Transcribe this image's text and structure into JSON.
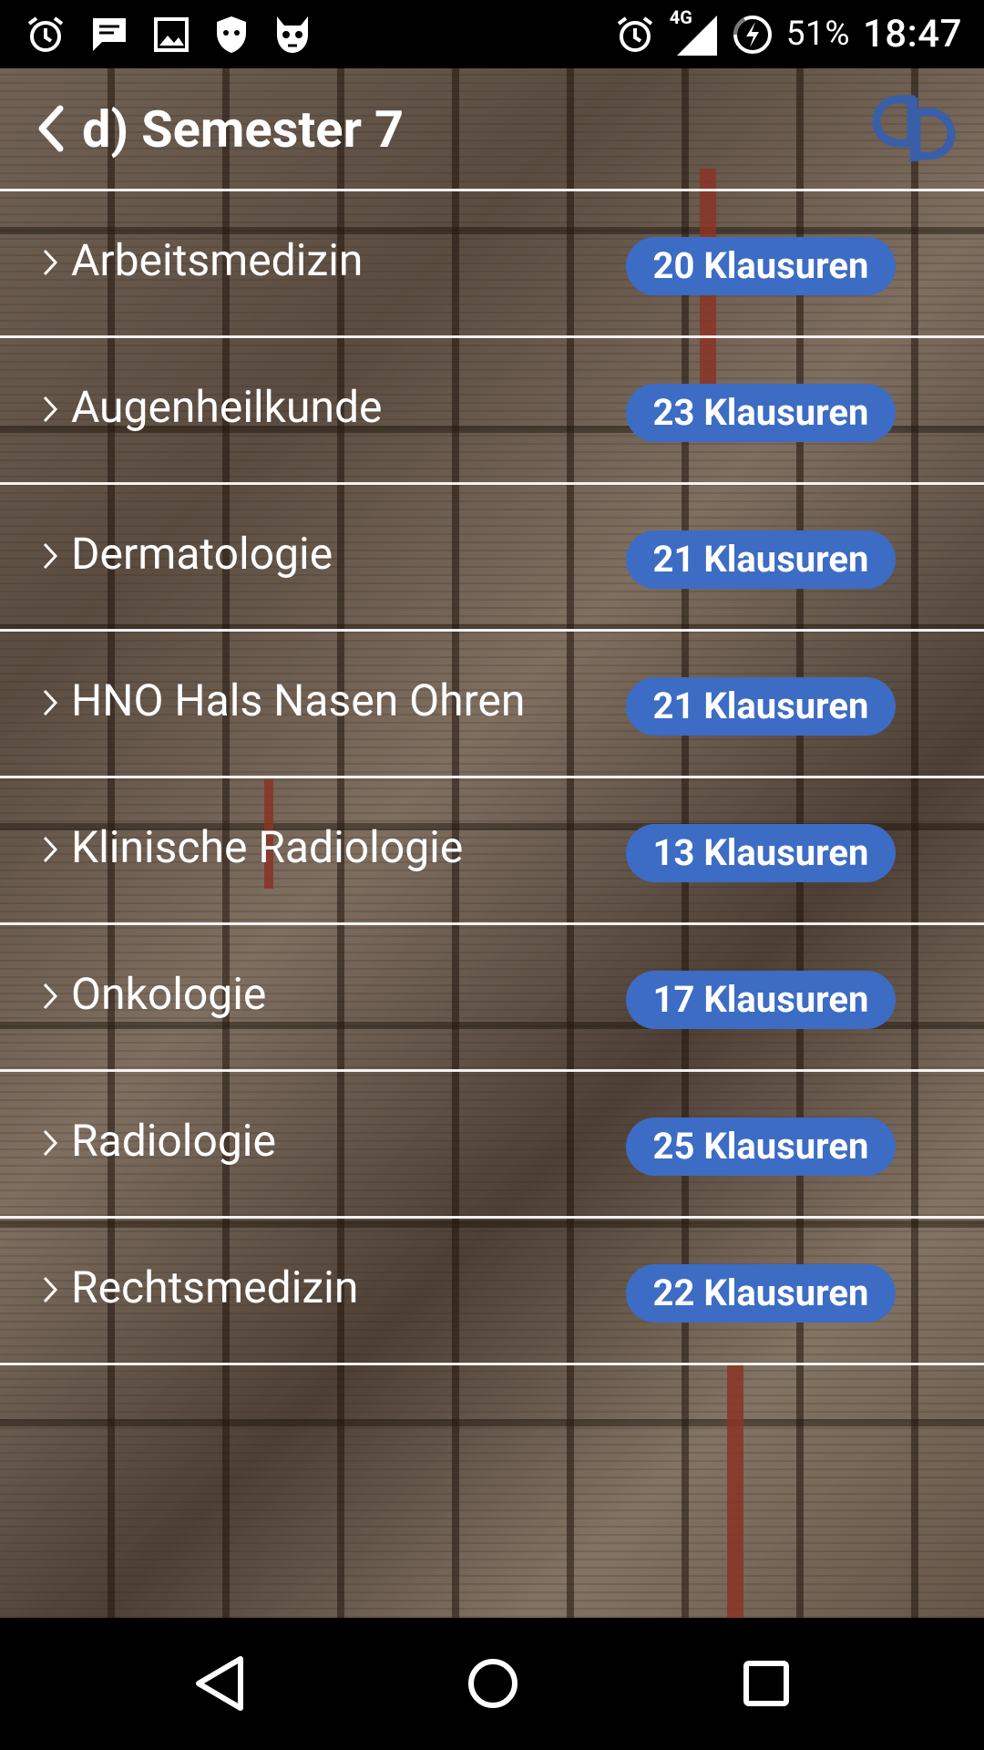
{
  "status_bar": {
    "left_icons": [
      "alarm-icon",
      "message-icon",
      "image-icon",
      "shield-icon",
      "cat-icon"
    ],
    "network_label": "4G",
    "battery_percent": "51%",
    "time": "18:47"
  },
  "header": {
    "title": "d) Semester 7",
    "logo": "app-logo"
  },
  "subjects": [
    {
      "name": "Arbeitsmedizin",
      "count": "20 Klausuren"
    },
    {
      "name": "Augenheilkunde",
      "count": "23 Klausuren"
    },
    {
      "name": "Dermatologie",
      "count": "21 Klausuren"
    },
    {
      "name": "HNO Hals Nasen Ohren",
      "count": "21 Klausuren"
    },
    {
      "name": "Klinische Radiologie",
      "count": "13 Klausuren"
    },
    {
      "name": "Onkologie",
      "count": "17 Klausuren"
    },
    {
      "name": "Radiologie",
      "count": "25 Klausuren"
    },
    {
      "name": "Rechtsmedizin",
      "count": "22 Klausuren"
    }
  ],
  "colors": {
    "badge": "#3d6cc4",
    "logo": "#3a5fa8"
  }
}
